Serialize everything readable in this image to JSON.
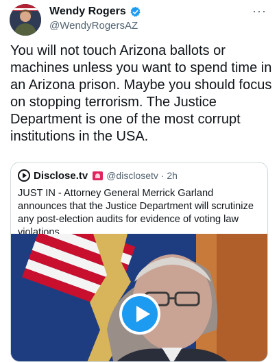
{
  "author": {
    "display_name": "Wendy Rogers",
    "handle": "@WendyRogersAZ",
    "avatar_icon": "profile-photo",
    "verified_icon": "verified-badge-icon",
    "more_label": "···"
  },
  "tweet": {
    "text": "You will not touch Arizona ballots or machines unless you want to spend time in an Arizona prison. Maybe you should focus on stopping terrorism. The Justice Department is one of the most corrupt institutions in the USA."
  },
  "quoted_tweet": {
    "name": "Disclose.tv",
    "handle_time": "@disclosetv · 2h",
    "text": "JUST IN - Attorney General Merrick Garland announces that the Justice Department will scrutinize any post-election audits for evidence of voting law violations.",
    "media_type": "video",
    "play_icon": "play-icon"
  },
  "colors": {
    "accent": "#1d9bf0",
    "text_primary": "#0f1419",
    "text_secondary": "#536471",
    "border": "#cfd9de",
    "badge_red": "#e0245e"
  }
}
